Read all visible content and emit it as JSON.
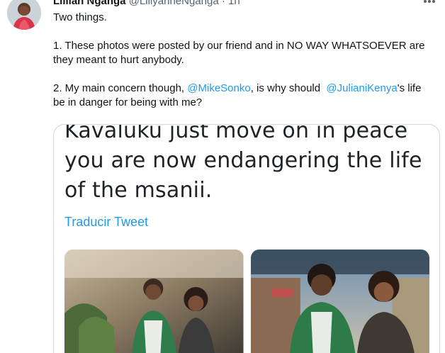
{
  "tweet": {
    "author_name": "Lillian Nganga",
    "author_handle": "@LillyanneNganga",
    "separator": "·",
    "time": "1h",
    "more_icon": "more-dots-icon",
    "line1": "Two things.",
    "point1": "1. These photos were posted by our friend and in NO WAY WHATSOEVER are they meant to hurt anybody.",
    "point2_a": "2. My main concern though, ",
    "point2_mention1": "@MikeSonko",
    "point2_b": ", is why should  ",
    "point2_mention2": "@JulianiKenya",
    "point2_c": "'s life be in danger for being with me?"
  },
  "quote": {
    "line1": "Kavaluku just move on in peace",
    "line2": "you are now endangering the life",
    "line3": "of the msanii.",
    "translate": "Traducir Tweet"
  },
  "colors": {
    "link": "#1d9bf0",
    "text": "#0f1419",
    "muted": "#536471",
    "border": "#cfd9de"
  }
}
